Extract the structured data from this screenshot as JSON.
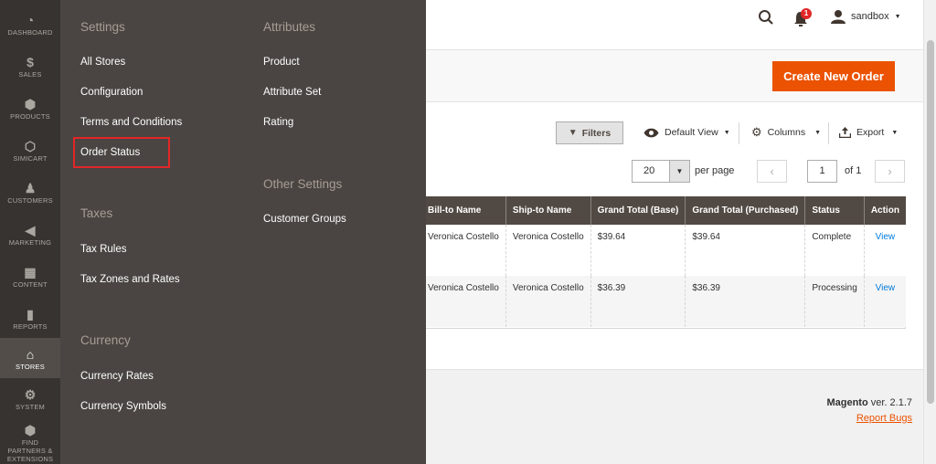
{
  "sidebar": {
    "items": [
      {
        "label": "DASHBOARD",
        "icon": "dashboard-icon",
        "glyph": "◔"
      },
      {
        "label": "SALES",
        "icon": "dollar-icon",
        "glyph": "$"
      },
      {
        "label": "PRODUCTS",
        "icon": "cube-icon",
        "glyph": "⬢"
      },
      {
        "label": "SIMICART",
        "icon": "hexagon-icon",
        "glyph": "⬡"
      },
      {
        "label": "CUSTOMERS",
        "icon": "person-icon",
        "glyph": "♟"
      },
      {
        "label": "MARKETING",
        "icon": "megaphone-icon",
        "glyph": "◀"
      },
      {
        "label": "CONTENT",
        "icon": "layout-icon",
        "glyph": "▦"
      },
      {
        "label": "REPORTS",
        "icon": "bar-chart-icon",
        "glyph": "▮"
      },
      {
        "label": "STORES",
        "icon": "store-icon",
        "glyph": "⌂"
      },
      {
        "label": "SYSTEM",
        "icon": "gear-icon",
        "glyph": "⚙"
      },
      {
        "label": "FIND PARTNERS & EXTENSIONS",
        "icon": "box-icon",
        "glyph": "⬢"
      }
    ]
  },
  "flyout": {
    "settings_title": "Settings",
    "settings_items": [
      "All Stores",
      "Configuration",
      "Terms and Conditions",
      "Order Status"
    ],
    "taxes_title": "Taxes",
    "taxes_items": [
      "Tax Rules",
      "Tax Zones and Rates"
    ],
    "currency_title": "Currency",
    "currency_items": [
      "Currency Rates",
      "Currency Symbols"
    ],
    "attributes_title": "Attributes",
    "attributes_items": [
      "Product",
      "Attribute Set",
      "Rating"
    ],
    "other_title": "Other Settings",
    "other_items": [
      "Customer Groups"
    ]
  },
  "header": {
    "notification_count": "1",
    "user": "sandbox"
  },
  "actions": {
    "create_order": "Create New Order"
  },
  "toolbar": {
    "filters": "Filters",
    "default_view": "Default View",
    "columns": "Columns",
    "export": "Export",
    "per_page_value": "20",
    "per_page_label": "per page",
    "page_value": "1",
    "page_of": "of 1"
  },
  "grid": {
    "columns": [
      "Bill-to Name",
      "Ship-to Name",
      "Grand Total (Base)",
      "Grand Total (Purchased)",
      "Status",
      "Action"
    ],
    "rows": [
      [
        "Veronica Costello",
        "Veronica Costello",
        "$39.64",
        "$39.64",
        "Complete",
        "View"
      ],
      [
        "Veronica Costello",
        "Veronica Costello",
        "$36.39",
        "$36.39",
        "Processing",
        "View"
      ]
    ]
  },
  "footer": {
    "brand": "Magento",
    "version": " ver. 2.1.7",
    "report_bugs": "Report Bugs"
  },
  "colors": {
    "accent": "#eb5202",
    "sidebar": "#373330",
    "flyout": "#4a4542",
    "grid_header": "#514943",
    "highlight": "#e22626"
  }
}
